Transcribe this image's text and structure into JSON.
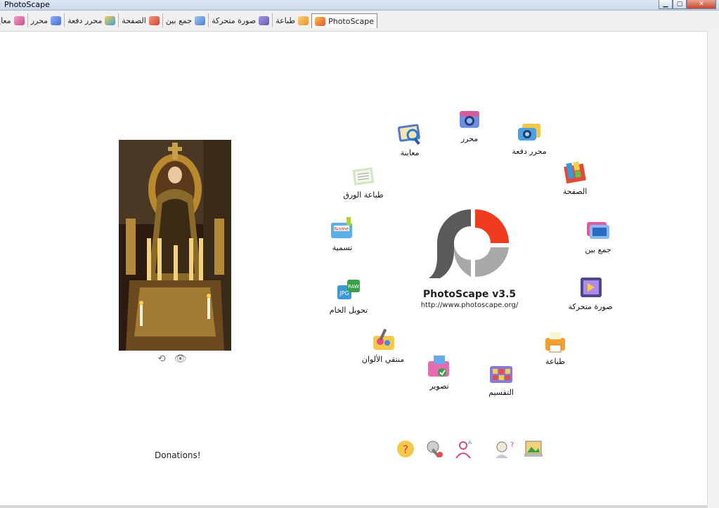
{
  "window": {
    "title": "PhotoScape"
  },
  "tabs": [
    {
      "label": "PhotoScape",
      "icon": "photoscape-tab-icon",
      "active": true,
      "color": "#e0563a"
    },
    {
      "label": "طباعة",
      "icon": "print-tab-icon",
      "color": "#e8932e"
    },
    {
      "label": "صورة متحركة",
      "icon": "animated-gif-tab-icon",
      "color": "#6b5fb0"
    },
    {
      "label": "جمع بين",
      "icon": "combine-tab-icon",
      "color": "#4a7fd0"
    },
    {
      "label": "الصفحة",
      "icon": "page-tab-icon",
      "color": "#d04040"
    },
    {
      "label": "محرر دفعة",
      "icon": "batch-editor-tab-icon",
      "color": "#3e9cd8"
    },
    {
      "label": "محرر",
      "icon": "editor-tab-icon",
      "color": "#4b6ed6"
    },
    {
      "label": "معاينة",
      "icon": "viewer-tab-icon",
      "color": "#c84b8a"
    }
  ],
  "menu": [
    {
      "key": "viewer",
      "label": "معاينة",
      "icon": "viewer-icon"
    },
    {
      "key": "editor",
      "label": "محرر",
      "icon": "editor-icon"
    },
    {
      "key": "batch",
      "label": "محرر دفعة",
      "icon": "batch-editor-icon"
    },
    {
      "key": "page",
      "label": "الصفحة",
      "icon": "page-icon"
    },
    {
      "key": "combine",
      "label": "جمع بين",
      "icon": "combine-icon"
    },
    {
      "key": "gif",
      "label": "صورة متحركة",
      "icon": "animated-gif-icon"
    },
    {
      "key": "print",
      "label": "طباعة",
      "icon": "print-icon"
    },
    {
      "key": "splitter",
      "label": "التقسيم",
      "icon": "splitter-icon"
    },
    {
      "key": "capture",
      "label": "تصوير",
      "icon": "screen-capture-icon"
    },
    {
      "key": "picker",
      "label": "منتقي الألوان",
      "icon": "color-picker-icon"
    },
    {
      "key": "raw",
      "label": "تحويل الخام",
      "icon": "raw-converter-icon"
    },
    {
      "key": "rename",
      "label": "تسمية",
      "icon": "rename-icon"
    },
    {
      "key": "paper",
      "label": "طباعة الورق",
      "icon": "paper-print-icon"
    }
  ],
  "logo": {
    "title": "PhotoScape v3.5",
    "url": "http://www.photoscape.org/"
  },
  "photo_tools": [
    "refresh-icon",
    "slideshow-eye-icon"
  ],
  "donations": "Donations!",
  "bottom_icons": [
    "help-icon",
    "settings-icon",
    "language-icon",
    "faq-icon",
    "wallpaper-icon"
  ],
  "colors": {
    "accent": "#f03c1e",
    "logo_gray": "#5a5a5a",
    "logo_light": "#a8a8a8"
  }
}
